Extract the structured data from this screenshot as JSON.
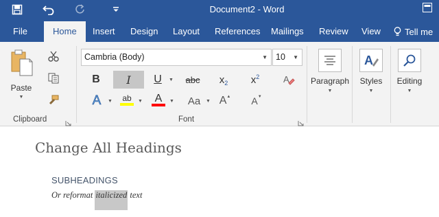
{
  "title_bar": {
    "document_title": "Document2 - Word",
    "save_icon": "save-icon",
    "undo_icon": "undo-icon",
    "redo_icon": "redo-icon",
    "customize_icon": "customize-qat-icon",
    "ribbon_display_icon": "ribbon-display-options-icon"
  },
  "tabs": [
    "File",
    "Home",
    "Insert",
    "Design",
    "Layout",
    "References",
    "Mailings",
    "Review",
    "View"
  ],
  "active_tab": "Home",
  "tell_me": "Tell me",
  "clipboard": {
    "paste_label": "Paste",
    "group_label": "Clipboard"
  },
  "font": {
    "font_name": "Cambria (Body)",
    "font_size": "10",
    "group_label": "Font",
    "bold": "B",
    "italic": "I",
    "underline": "U",
    "strikethrough": "abc",
    "subscript": "x",
    "subscript_mark": "2",
    "superscript": "x",
    "superscript_mark": "2",
    "text_effects": "A",
    "highlight": "ab",
    "font_color": "A",
    "change_case": "Aa",
    "grow_font": "A",
    "shrink_font": "A"
  },
  "paragraph_label": "Paragraph",
  "styles_label": "Styles",
  "editing_label": "Editing",
  "document": {
    "heading1": "Change All Headings",
    "heading2": "SUBHEADINGS",
    "body_before": "Or reformat ",
    "body_selected": "italicized",
    "body_after": " text"
  },
  "colors": {
    "accent": "#2b579a",
    "ribbon_bg": "#f3f3f3",
    "highlight_yellow": "#ffff00",
    "font_red": "#ff0000"
  }
}
